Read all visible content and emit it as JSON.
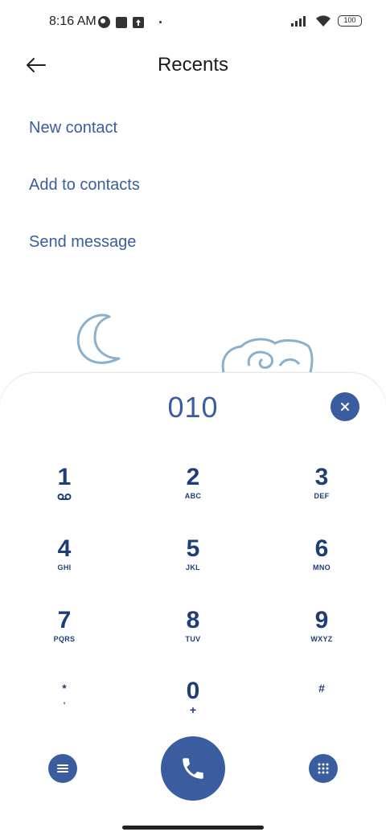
{
  "status_bar": {
    "time": "8:16 AM",
    "battery": "100"
  },
  "header": {
    "title": "Recents",
    "back_icon": "arrow-left-icon"
  },
  "actions": [
    {
      "label": "New contact"
    },
    {
      "label": "Add to contacts"
    },
    {
      "label": "Send message"
    }
  ],
  "dialer": {
    "number": "010",
    "clear_icon": "close-icon",
    "keys": [
      {
        "digit": "1",
        "letters": ""
      },
      {
        "digit": "2",
        "letters": "ABC"
      },
      {
        "digit": "3",
        "letters": "DEF"
      },
      {
        "digit": "4",
        "letters": "GHI"
      },
      {
        "digit": "5",
        "letters": "JKL"
      },
      {
        "digit": "6",
        "letters": "MNO"
      },
      {
        "digit": "7",
        "letters": "PQRS"
      },
      {
        "digit": "8",
        "letters": "TUV"
      },
      {
        "digit": "9",
        "letters": "WXYZ"
      },
      {
        "digit": "*",
        "letters": ","
      },
      {
        "digit": "0",
        "letters": "+"
      },
      {
        "digit": "#",
        "letters": ""
      }
    ],
    "menu_icon": "menu-icon",
    "call_icon": "phone-icon",
    "keypad_icon": "dialpad-icon"
  },
  "colors": {
    "accent": "#3a5da0",
    "key_text": "#1f3d7a"
  }
}
